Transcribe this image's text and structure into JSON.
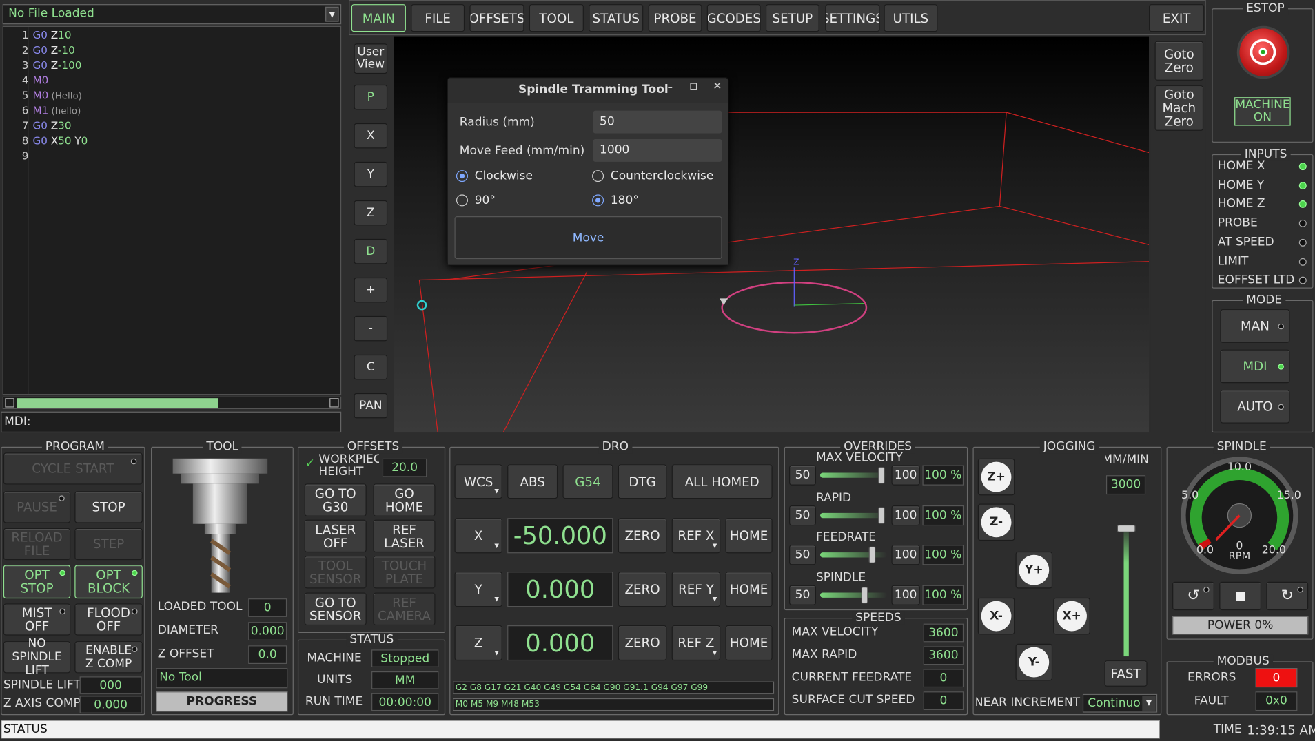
{
  "file": {
    "name": "No File Loaded"
  },
  "gcode": [
    {
      "n": "1",
      "parts": [
        [
          "g",
          "G0"
        ],
        [
          "t",
          " Z"
        ],
        [
          "n",
          "10"
        ]
      ]
    },
    {
      "n": "2",
      "parts": [
        [
          "g",
          "G0"
        ],
        [
          "t",
          " Z"
        ],
        [
          "n",
          "-10"
        ]
      ]
    },
    {
      "n": "3",
      "parts": [
        [
          "g",
          "G0"
        ],
        [
          "t",
          " Z"
        ],
        [
          "n",
          "-100"
        ]
      ]
    },
    {
      "n": "4",
      "parts": [
        [
          "m",
          "M0"
        ]
      ]
    },
    {
      "n": "5",
      "parts": [
        [
          "m",
          "M0"
        ],
        [
          "c",
          " (Hello)"
        ]
      ]
    },
    {
      "n": "6",
      "parts": [
        [
          "m",
          "M1"
        ],
        [
          "c",
          " (hello)"
        ]
      ]
    },
    {
      "n": "7",
      "parts": [
        [
          "g",
          "G0"
        ],
        [
          "t",
          " Z"
        ],
        [
          "n",
          "30"
        ]
      ]
    },
    {
      "n": "8",
      "parts": [
        [
          "g",
          "G0"
        ],
        [
          "t",
          " X"
        ],
        [
          "n",
          "50"
        ],
        [
          "t",
          " Y"
        ],
        [
          "n",
          "0"
        ]
      ]
    },
    {
      "n": "9",
      "parts": []
    }
  ],
  "mdi": {
    "label": "MDI:"
  },
  "tabs": [
    "MAIN",
    "FILE",
    "OFFSETS",
    "TOOL",
    "STATUS",
    "PROBE",
    "GCODES",
    "SETUP",
    "SETTINGS",
    "UTILS"
  ],
  "exit": "EXIT",
  "view_buttons": {
    "user_view": "User View",
    "p": "P",
    "x": "X",
    "y": "Y",
    "z": "Z",
    "d": "D",
    "plus": "+",
    "minus": "-",
    "c": "C",
    "pan": "PAN"
  },
  "goto_zero": "Goto Zero",
  "goto_mach_zero": "Goto Mach Zero",
  "preview": {
    "axis_label": "Z"
  },
  "dialog": {
    "title": "Spindle Tramming Tool",
    "radius_label": "Radius (mm)",
    "radius_value": "50",
    "feed_label": "Move Feed (mm/min)",
    "feed_value": "1000",
    "clockwise": "Clockwise",
    "counterclockwise": "Counterclockwise",
    "deg90": "90°",
    "deg180": "180°",
    "move": "Move"
  },
  "estop": {
    "title": "ESTOP",
    "machine_on": "MACHINE ON"
  },
  "inputs": {
    "title": "INPUTS",
    "items": [
      {
        "label": "HOME X",
        "on": true
      },
      {
        "label": "HOME Y",
        "on": true
      },
      {
        "label": "HOME Z",
        "on": true
      },
      {
        "label": "PROBE",
        "on": false
      },
      {
        "label": "AT SPEED",
        "on": false
      },
      {
        "label": "LIMIT",
        "on": false
      },
      {
        "label": "EOFFSET LTD",
        "on": false
      }
    ]
  },
  "mode": {
    "title": "MODE",
    "man": "MAN",
    "mdi": "MDI",
    "auto": "AUTO"
  },
  "program": {
    "title": "PROGRAM",
    "cycle_start": "CYCLE START",
    "pause": "PAUSE",
    "stop": "STOP",
    "reload": "RELOAD FILE",
    "step": "STEP",
    "opt_stop": "OPT STOP",
    "opt_block": "OPT BLOCK",
    "mist": "MIST OFF",
    "flood": "FLOOD OFF",
    "no_spindle_lift": "NO SPINDLE LIFT",
    "enable_zcomp": "ENABLE Z COMP",
    "spindle_lift_label": "SPINDLE LIFT",
    "spindle_lift_value": "000",
    "zaxis_comp_label": "Z AXIS COMP",
    "zaxis_comp_value": "0.000"
  },
  "tool": {
    "title": "TOOL",
    "loaded_label": "LOADED TOOL",
    "loaded_value": "0",
    "diameter_label": "DIAMETER",
    "diameter_value": "0.000",
    "zoffset_label": "Z OFFSET",
    "zoffset_value": "0.0",
    "tool_name": "No Tool",
    "progress": "PROGRESS"
  },
  "offsets": {
    "title": "OFFSETS",
    "workpiece_label": "WORKPIECE HEIGHT",
    "workpiece_value": "20.0",
    "goto_g30": "GO TO G30",
    "go_home": "GO HOME",
    "laser_off": "LASER OFF",
    "ref_laser": "REF LASER",
    "tool_sensor": "TOOL SENSOR",
    "touch_plate": "TOUCH PLATE",
    "goto_sensor": "GO TO SENSOR",
    "ref_camera": "REF CAMERA"
  },
  "status": {
    "title": "STATUS",
    "machine_label": "MACHINE",
    "machine_value": "Stopped",
    "units_label": "UNITS",
    "units_value": "MM",
    "runtime_label": "RUN TIME",
    "runtime_value": "00:00:00"
  },
  "dro": {
    "title": "DRO",
    "wcs": "WCS",
    "abs": "ABS",
    "g54": "G54",
    "dtg": "DTG",
    "all_homed": "ALL HOMED",
    "zero": "ZERO",
    "home": "HOME",
    "axes": [
      {
        "name": "X",
        "value": "-50.000",
        "ref": "REF X"
      },
      {
        "name": "Y",
        "value": "0.000",
        "ref": "REF Y"
      },
      {
        "name": "Z",
        "value": "0.000",
        "ref": "REF Z"
      }
    ],
    "gcodes": "G2 G8 G17 G21 G40 G49 G54 G64 G90 G91.1 G94 G97 G99",
    "mcodes": "M0 M5 M9 M48 M53"
  },
  "overrides": {
    "title": "OVERRIDES",
    "items": [
      {
        "label": "MAX VELOCITY",
        "min": "50",
        "max": "100",
        "pct": "100 %"
      },
      {
        "label": "RAPID",
        "min": "50",
        "max": "100",
        "pct": "100 %"
      },
      {
        "label": "FEEDRATE",
        "min": "50",
        "max": "100",
        "pct": "100 %"
      },
      {
        "label": "SPINDLE",
        "min": "50",
        "max": "100",
        "pct": "100 %"
      }
    ]
  },
  "speeds": {
    "title": "SPEEDS",
    "items": [
      {
        "label": "MAX VELOCITY",
        "value": "3600"
      },
      {
        "label": "MAX RAPID",
        "value": "3600"
      },
      {
        "label": "CURRENT FEEDRATE",
        "value": "0"
      },
      {
        "label": "SURFACE CUT SPEED",
        "value": "0"
      }
    ]
  },
  "jogging": {
    "title": "JOGGING",
    "units": "MM/MIN",
    "rate": "3000",
    "fast": "FAST",
    "zplus": "Z+",
    "zminus": "Z-",
    "yplus": "Y+",
    "yminus": "Y-",
    "xplus": "X+",
    "xminus": "X-",
    "linear_label": "LINEAR INCREMENT",
    "linear_value": "Continuous"
  },
  "spindle": {
    "title": "SPINDLE",
    "gauge_labels": [
      "10.0",
      "5.0",
      "15.0",
      "0.0",
      "20.0"
    ],
    "rpm_value": "0",
    "rpm_unit": "RPM",
    "power": "POWER 0%"
  },
  "modbus": {
    "title": "MODBUS",
    "errors_label": "ERRORS",
    "errors_value": "0",
    "fault_label": "FAULT",
    "fault_value": "0x0"
  },
  "statusbar": {
    "label": "STATUS",
    "time_label": "TIME",
    "time_value": "1:39:15 AM"
  }
}
